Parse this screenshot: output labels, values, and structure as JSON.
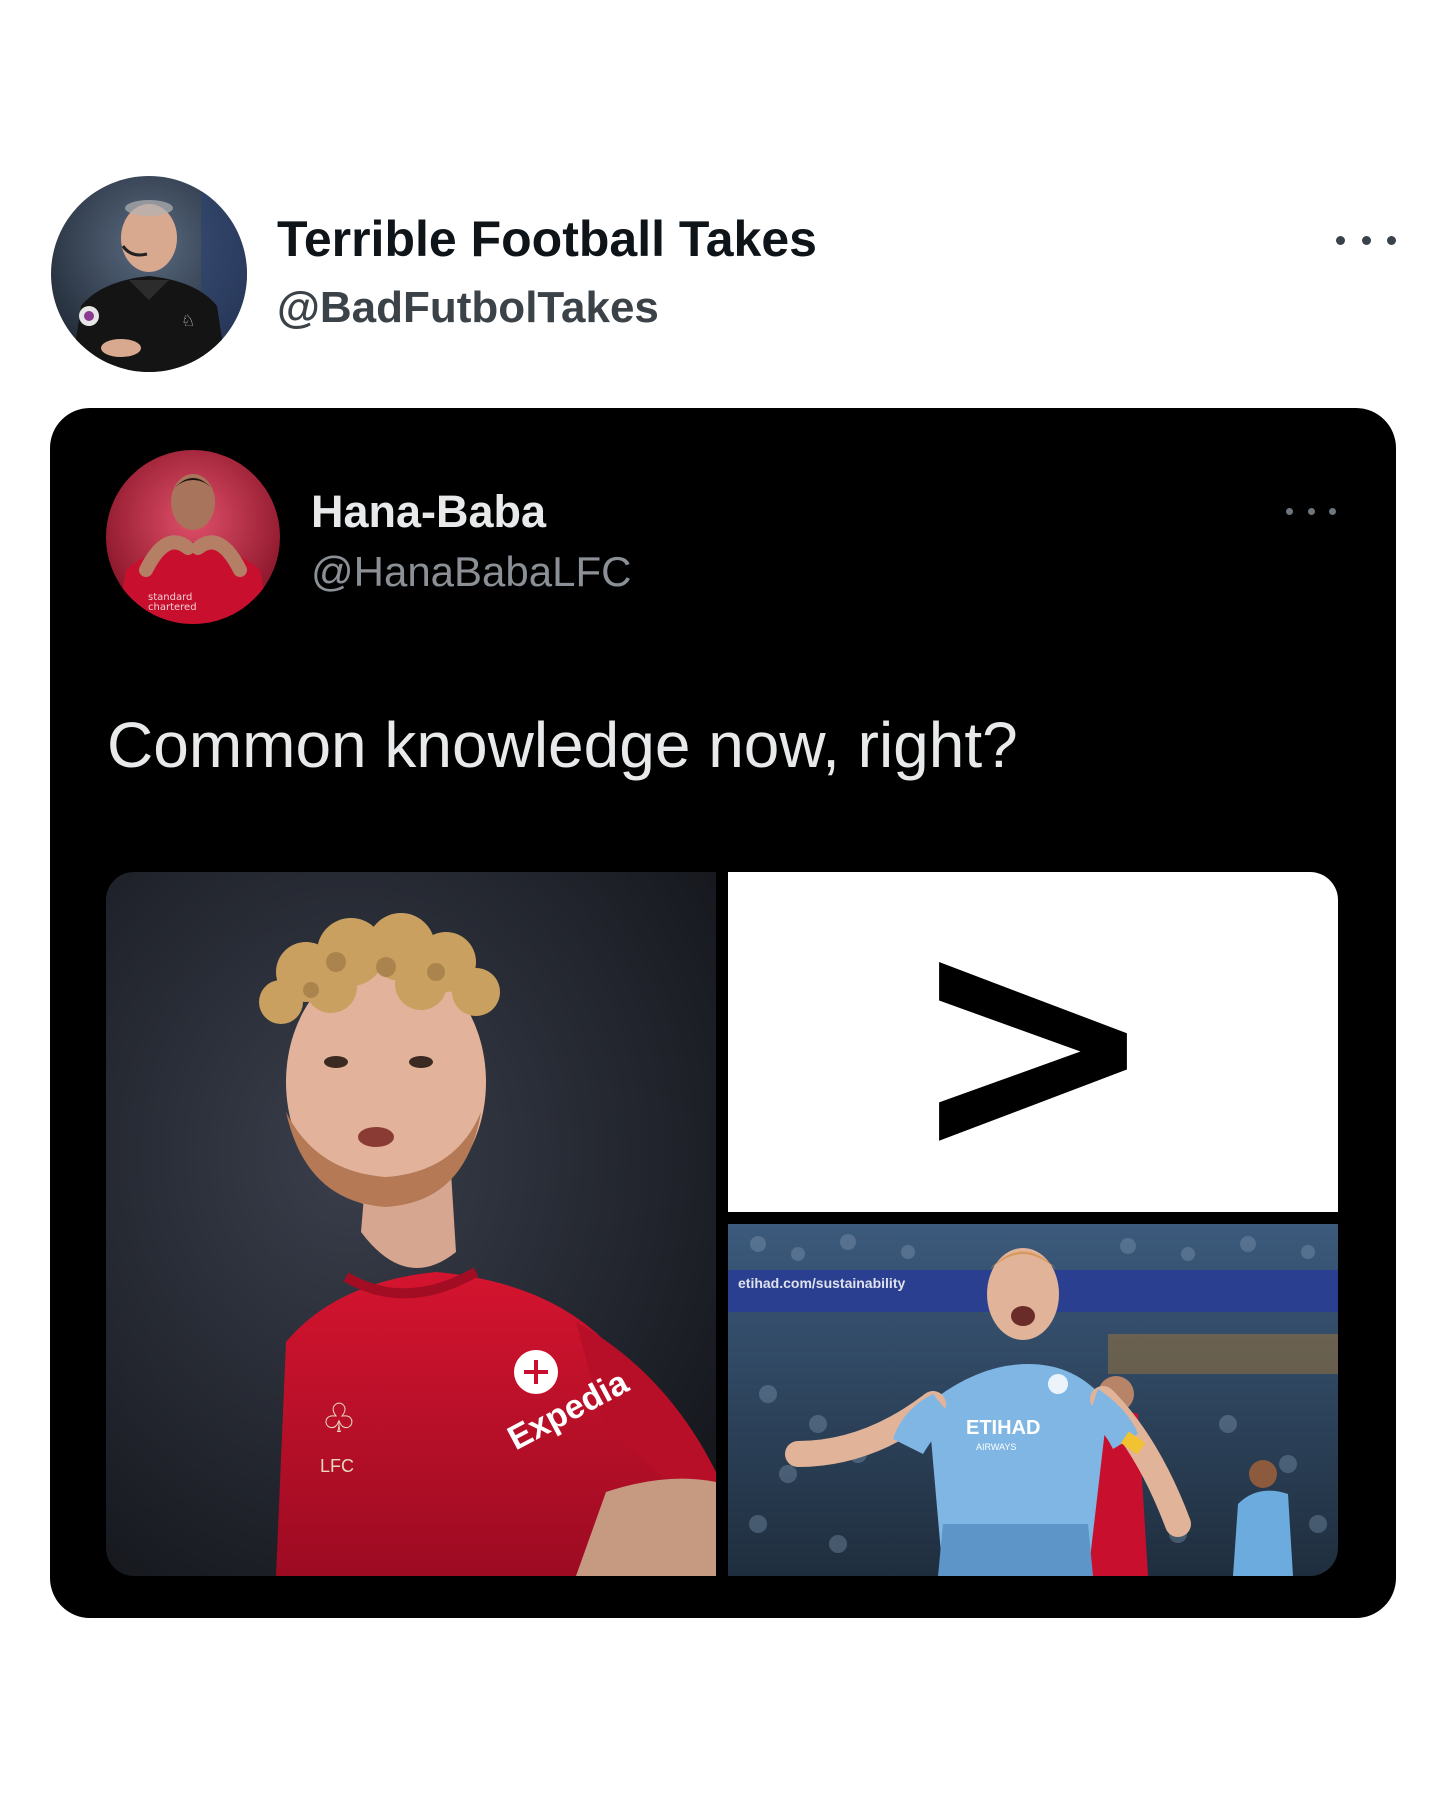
{
  "outer_tweet": {
    "display_name": "Terrible Football Takes",
    "handle": "@BadFutbolTakes",
    "avatar_icon": "referee-avatar",
    "more_icon": "more-options-icon"
  },
  "quoted_tweet": {
    "display_name": "Hana-Baba",
    "handle": "@HanaBabaLFC",
    "avatar_icon": "liverpool-player-avatar",
    "more_icon": "more-options-icon",
    "text": "Common knowledge now, right?"
  },
  "media": {
    "left_image": {
      "description_icon": "liverpool-player-photo",
      "shirt_sponsor": "Expedia",
      "crest_text": "LFC"
    },
    "top_right_image": {
      "symbol": ">"
    },
    "bottom_right_image": {
      "description_icon": "manchester-city-player-photo",
      "banner_text": "etihad.com/sustainability",
      "shirt_sponsor": "ETIHAD",
      "shirt_sponsor_sub": "AIRWAYS"
    }
  },
  "colors": {
    "card_background": "#000000",
    "liverpool_red": "#c8102e",
    "city_blue": "#6cabdd"
  }
}
